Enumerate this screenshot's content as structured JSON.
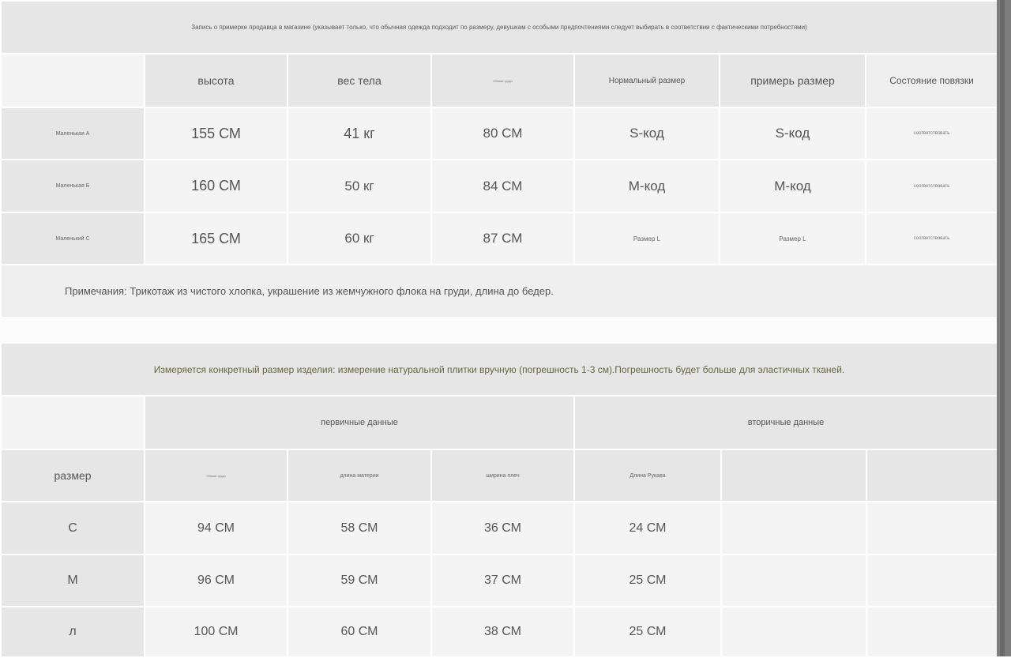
{
  "fitting": {
    "title": "Запись о примерке продавца в магазине (указывает только, что обычная одежда подходит по размеру, девушкам с особыми предпочтениями следует выбирать в соответствии с фактическими потребностями)",
    "headers": [
      "",
      "высота",
      "вес тела",
      "Обхват груди",
      "Нормальный размер",
      "примерь размер",
      "Состояние повязки"
    ],
    "rows": [
      [
        "Маленькая А",
        "155 СМ",
        "41 кг",
        "80 СМ",
        "S-код",
        "S-код",
        "соответствовать"
      ],
      [
        "Маленькая Б",
        "160 СМ",
        "50 кг",
        "84 СМ",
        "М-код",
        "М-код",
        "соответствовать"
      ],
      [
        "Маленький С",
        "165 СМ",
        "60 кг",
        "87 СМ",
        "Размер L",
        "Размер L",
        "соответствовать"
      ]
    ],
    "note": "Примечания: Трикотаж из чистого хлопка, украшение из жемчужного флока на груди, длина до бедер."
  },
  "measure": {
    "title": "Измеряется конкретный размер изделия: измерение натуральной плитки вручную (погрешность 1-3 см).Погрешность будет больше для эластичных тканей.",
    "group_primary": "первичные данные",
    "group_secondary": "вторичные данные",
    "size_label": "размер",
    "headers": [
      "Обхват груди",
      "длина материи",
      "ширина плеч",
      "Длина Рукава",
      "",
      ""
    ],
    "rows": [
      [
        "С",
        "94 СМ",
        "58 СМ",
        "36 СМ",
        "24 СМ",
        "",
        ""
      ],
      [
        "М",
        "96 СМ",
        "59 СМ",
        "37 СМ",
        "25 СМ",
        "",
        ""
      ],
      [
        "л",
        "100 СМ",
        "60 СМ",
        "38 СМ",
        "25 СМ",
        "",
        ""
      ]
    ]
  }
}
